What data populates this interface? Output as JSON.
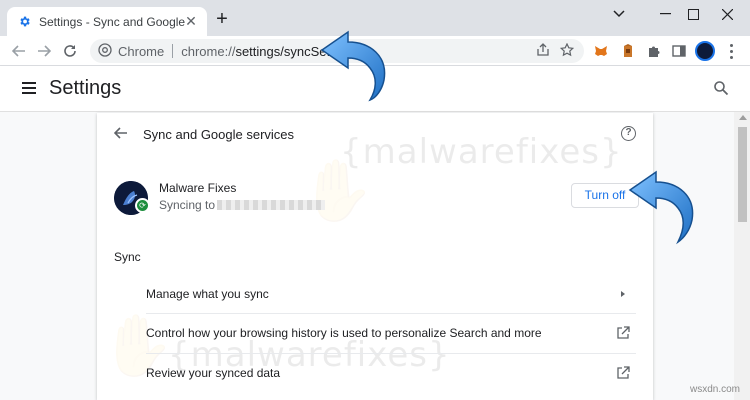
{
  "browser": {
    "tab_title": "Settings - Sync and Google servic",
    "omnibox_label": "Chrome",
    "url_scheme": "chrome://",
    "url_path": "settings/syncSetup"
  },
  "settings": {
    "title": "Settings"
  },
  "page": {
    "section_title": "Sync and Google services",
    "account": {
      "name": "Malware Fixes",
      "status_prefix": "Syncing to"
    },
    "turn_off_label": "Turn off",
    "sync_heading": "Sync",
    "rows": [
      {
        "label": "Manage what you sync"
      },
      {
        "label": "Control how your browsing history is used to personalize Search and more"
      },
      {
        "label": "Review your synced data"
      }
    ]
  },
  "watermarks": {
    "top": "{malwarefixes}",
    "bottom": "{malwarefixes}",
    "site": "wsxdn.com"
  },
  "colors": {
    "accent": "#1a73e8",
    "sync_green": "#1e8e3e",
    "callout_arrow": "#2f86d6"
  }
}
